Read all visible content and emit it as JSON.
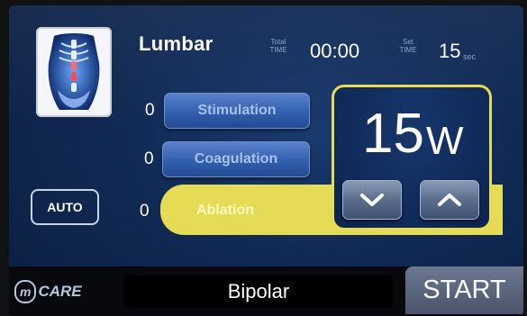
{
  "header": {
    "region_title": "Lumbar",
    "total_time_label_1": "Total",
    "total_time_label_2": "TIME",
    "total_time_value": "00:00",
    "set_time_label_1": "Set",
    "set_time_label_2": "TIME",
    "set_time_value": "15",
    "set_time_unit": "sec"
  },
  "modes": [
    {
      "count": "0",
      "label": "Stimulation"
    },
    {
      "count": "0",
      "label": "Coagulation"
    },
    {
      "count": "0",
      "label": "Ablation"
    }
  ],
  "auto_label": "AUTO",
  "power": {
    "value": "15",
    "unit": "W"
  },
  "footer": {
    "logo_mark": "m",
    "logo_text": "CARE",
    "mode_display": "Bipolar",
    "start_label": "START"
  },
  "icons": {
    "power_down": "chevron-down-icon",
    "power_up": "chevron-up-icon",
    "region": "spine-xray-thumbnail"
  },
  "colors": {
    "highlight": "#e6db54",
    "button_blue": "#325fad",
    "background": "#112a55"
  }
}
